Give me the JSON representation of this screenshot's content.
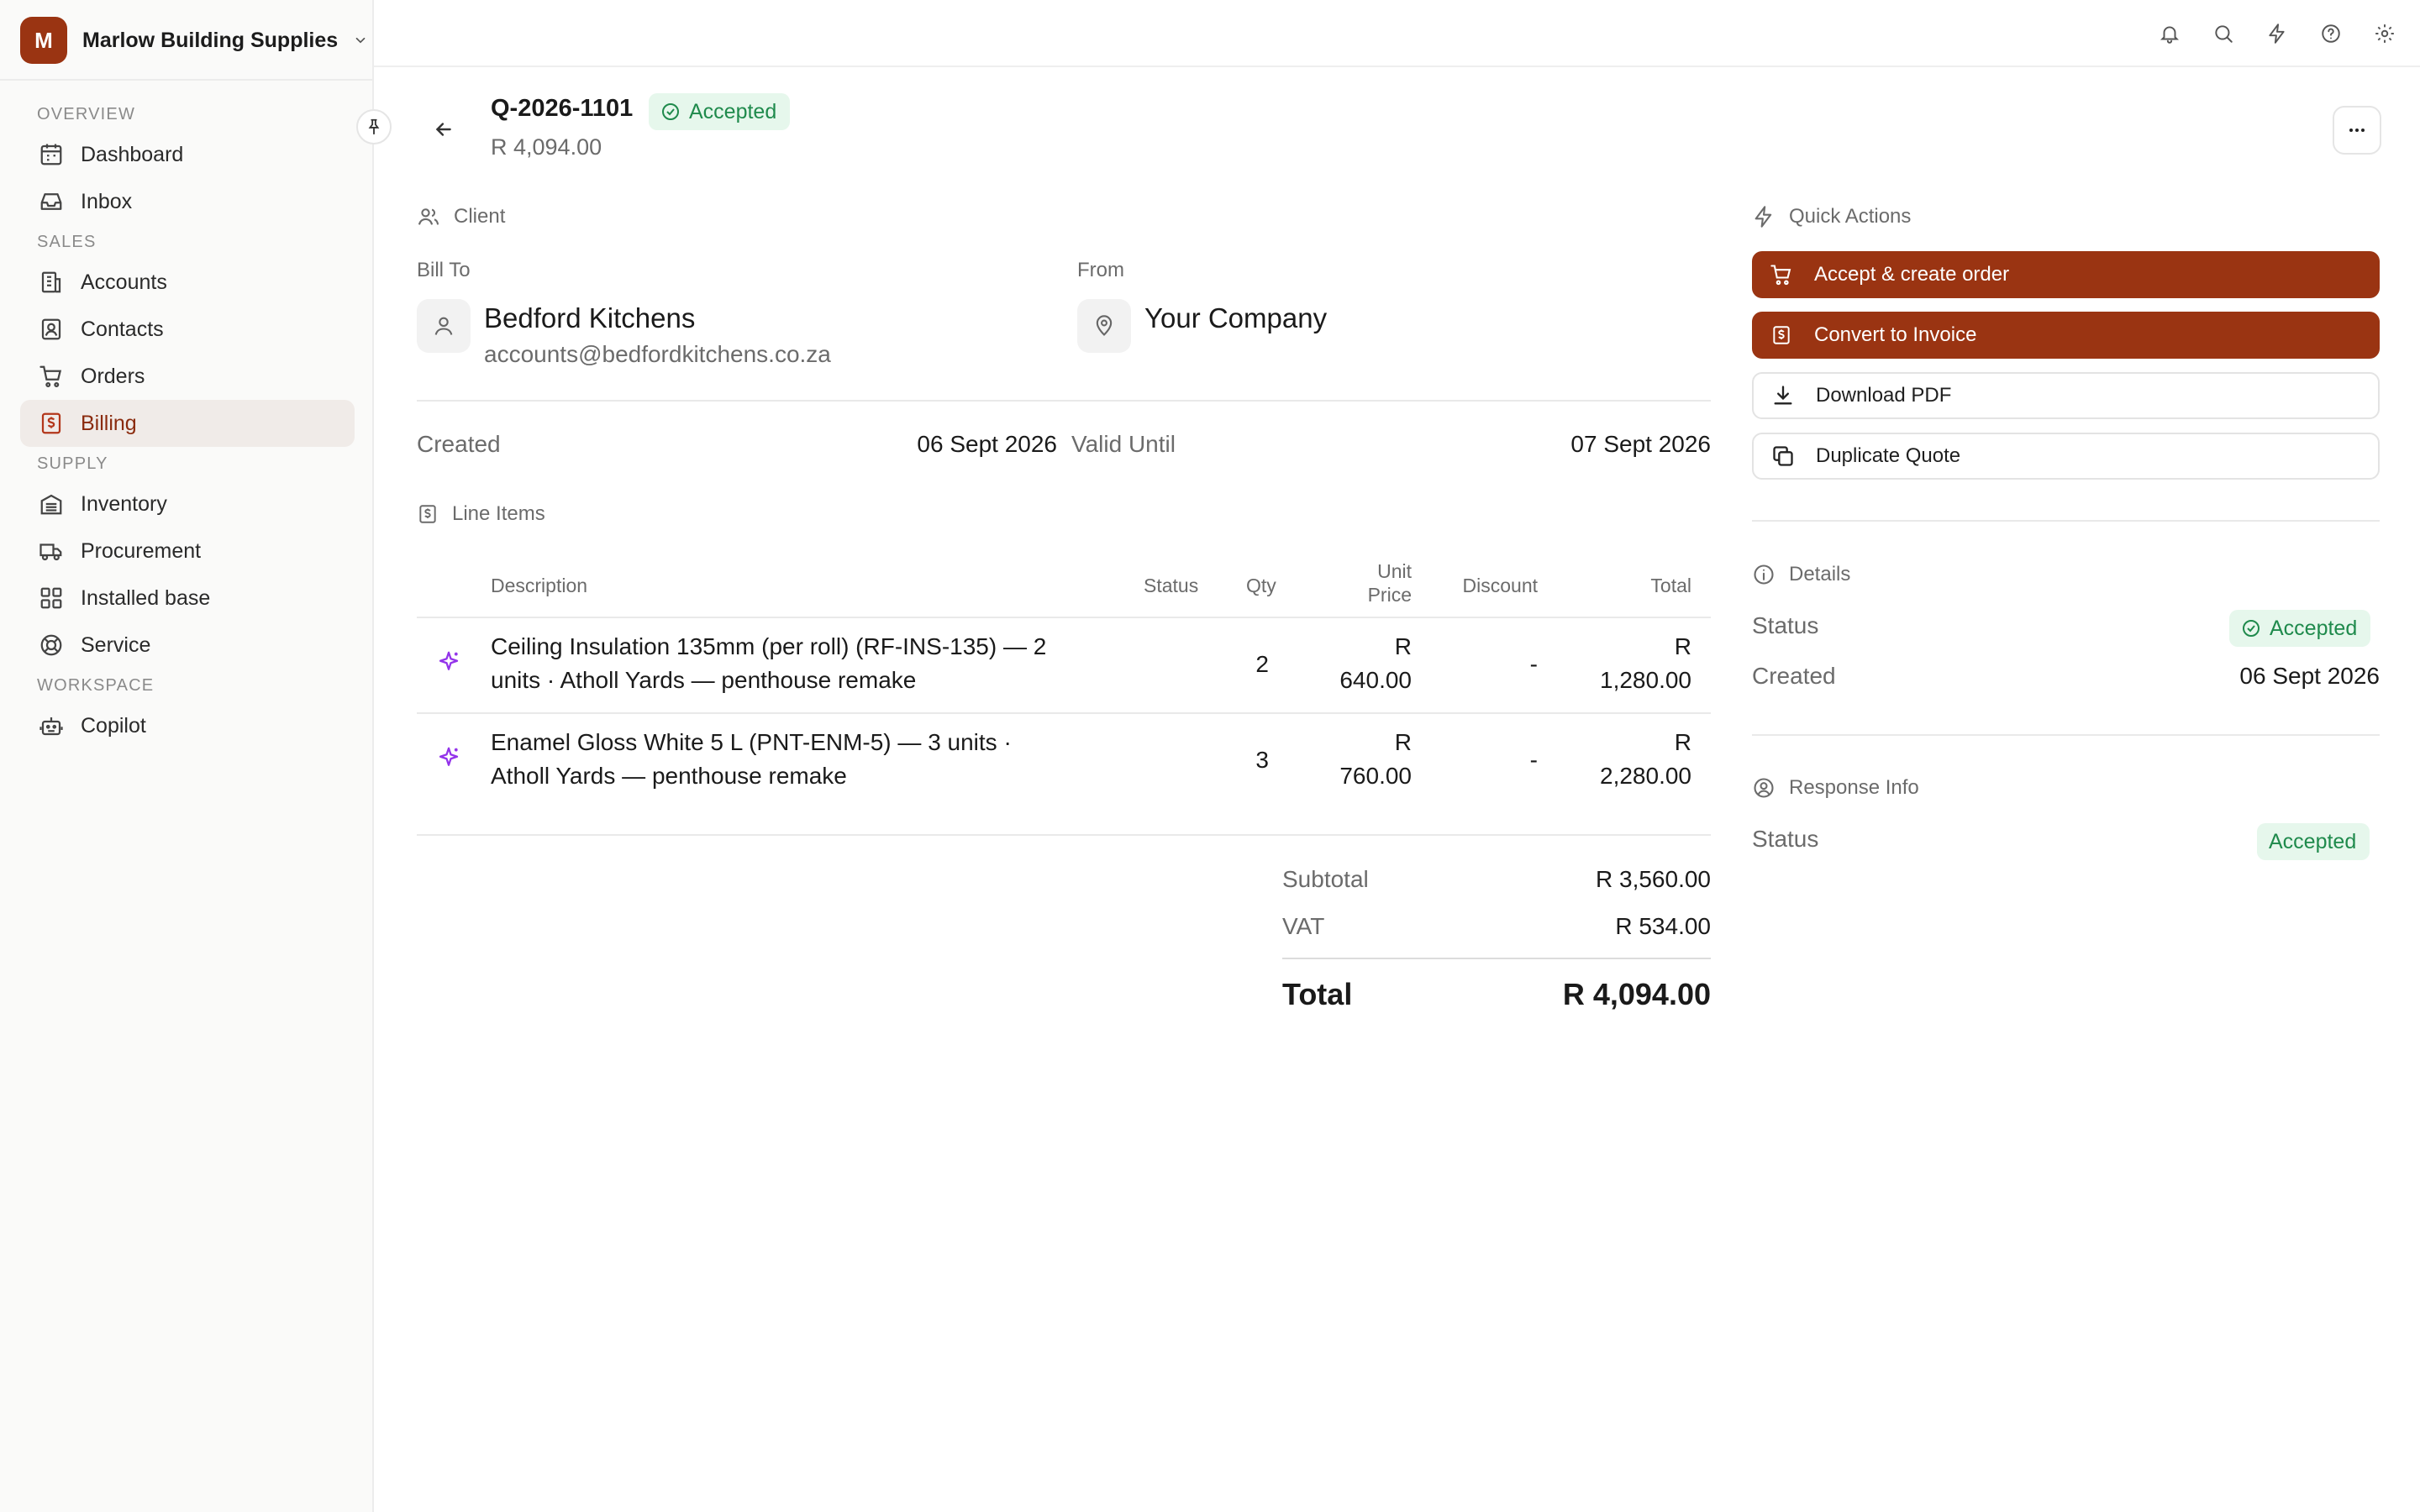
{
  "workspace": {
    "initial": "M",
    "name": "Marlow Building Supplies"
  },
  "sidebar": {
    "sections": [
      {
        "title": "OVERVIEW",
        "items": [
          {
            "label": "Dashboard",
            "icon": "calendar-grid-icon"
          },
          {
            "label": "Inbox",
            "icon": "inbox-icon"
          }
        ]
      },
      {
        "title": "SALES",
        "items": [
          {
            "label": "Accounts",
            "icon": "building-icon"
          },
          {
            "label": "Contacts",
            "icon": "contact-card-icon"
          },
          {
            "label": "Orders",
            "icon": "cart-icon"
          },
          {
            "label": "Billing",
            "icon": "billing-icon",
            "active": true
          }
        ]
      },
      {
        "title": "SUPPLY",
        "items": [
          {
            "label": "Inventory",
            "icon": "warehouse-icon"
          },
          {
            "label": "Procurement",
            "icon": "truck-icon"
          },
          {
            "label": "Installed base",
            "icon": "grid-icon"
          },
          {
            "label": "Service",
            "icon": "lifebuoy-icon"
          }
        ]
      },
      {
        "title": "WORKSPACE",
        "items": [
          {
            "label": "Copilot",
            "icon": "robot-icon"
          }
        ]
      }
    ]
  },
  "topbar": {
    "icons": [
      "bell-icon",
      "search-icon",
      "bolt-icon",
      "help-icon",
      "settings-icon"
    ]
  },
  "quote": {
    "id": "Q-2026-1101",
    "status": "Accepted",
    "amount": "R 4,094.00"
  },
  "client": {
    "section_title": "Client",
    "bill_to_label": "Bill To",
    "bill_to_name": "Bedford Kitchens",
    "bill_to_email": "accounts@bedfordkitchens.co.za",
    "from_label": "From",
    "from_name": "Your Company"
  },
  "dates": {
    "created_label": "Created",
    "created_value": "06 Sept 2026",
    "valid_label": "Valid Until",
    "valid_value": "07 Sept 2026"
  },
  "line_items": {
    "section_title": "Line Items",
    "headers": {
      "description": "Description",
      "status": "Status",
      "qty": "Qty",
      "unit_price_1": "Unit",
      "unit_price_2": "Price",
      "discount": "Discount",
      "total": "Total"
    },
    "rows": [
      {
        "desc_1": "Ceiling Insulation 135mm (per roll) (RF-INS-135) — 2",
        "desc_2": "units · Atholl Yards — penthouse remake",
        "qty": "2",
        "price_1": "R",
        "price_2": "640.00",
        "discount": "-",
        "total_1": "R",
        "total_2": "1,280.00"
      },
      {
        "desc_1": "Enamel Gloss White 5 L (PNT-ENM-5) — 3 units ·",
        "desc_2": "Atholl Yards — penthouse remake",
        "qty": "3",
        "price_1": "R",
        "price_2": "760.00",
        "discount": "-",
        "total_1": "R",
        "total_2": "2,280.00"
      }
    ]
  },
  "summary": {
    "subtotal_label": "Subtotal",
    "subtotal_value": "R 3,560.00",
    "vat_label": "VAT",
    "vat_value": "R 534.00",
    "total_label": "Total",
    "total_value": "R 4,094.00"
  },
  "quick_actions": {
    "title": "Quick Actions",
    "buttons": [
      {
        "label": "Accept & create order",
        "style": "primary",
        "icon": "cart-icon"
      },
      {
        "label": "Convert to Invoice",
        "style": "primary",
        "icon": "invoice-icon"
      },
      {
        "label": "Download PDF",
        "style": "secondary",
        "icon": "download-icon"
      },
      {
        "label": "Duplicate Quote",
        "style": "secondary",
        "icon": "copy-icon"
      }
    ]
  },
  "details": {
    "title": "Details",
    "status_label": "Status",
    "status_value": "Accepted",
    "created_label": "Created",
    "created_value": "06 Sept 2026"
  },
  "response_info": {
    "title": "Response Info",
    "status_label": "Status",
    "status_value": "Accepted"
  },
  "colors": {
    "brand": "#9a3412",
    "success_bg": "#e6f7ec",
    "success_text": "#1f8a4c",
    "sparkle": "#9333ea"
  }
}
